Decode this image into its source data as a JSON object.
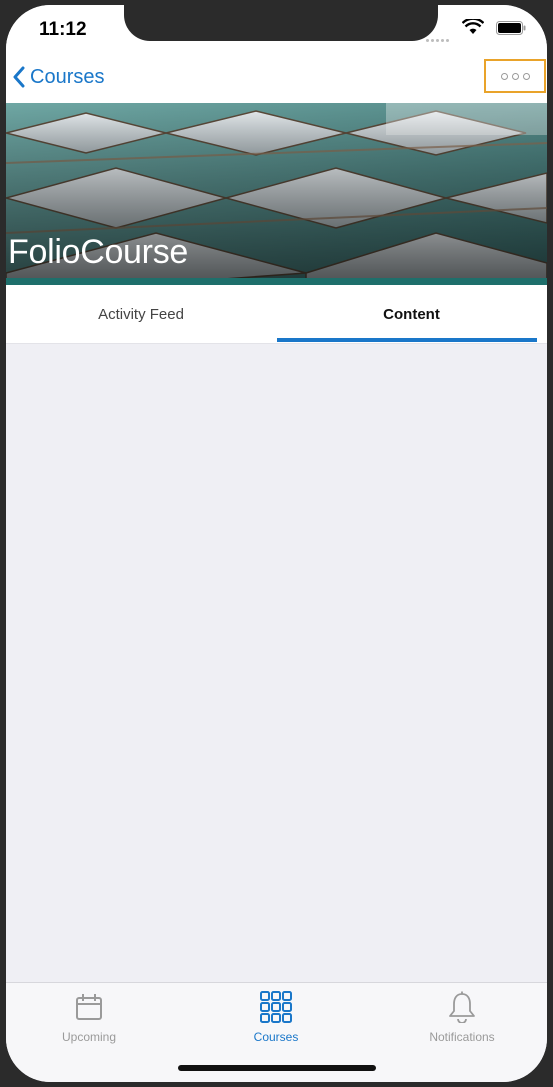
{
  "status_bar": {
    "time": "11:12"
  },
  "nav": {
    "back_label": "Courses",
    "more_icon": "ellipsis-icon",
    "more_highlight_color": "#e9a32a"
  },
  "hero": {
    "course_title": "FolioCourse"
  },
  "tabs": [
    {
      "label": "Activity Feed",
      "selected": false
    },
    {
      "label": "Content",
      "selected": true
    }
  ],
  "bottom_tabs": [
    {
      "label": "Upcoming",
      "icon": "calendar-icon",
      "selected": false
    },
    {
      "label": "Courses",
      "icon": "grid-icon",
      "selected": true
    },
    {
      "label": "Notifications",
      "icon": "bell-icon",
      "selected": false
    }
  ],
  "colors": {
    "accent": "#1a77c9",
    "hero_accent": "#1e6f6b",
    "background": "#efeff4"
  }
}
